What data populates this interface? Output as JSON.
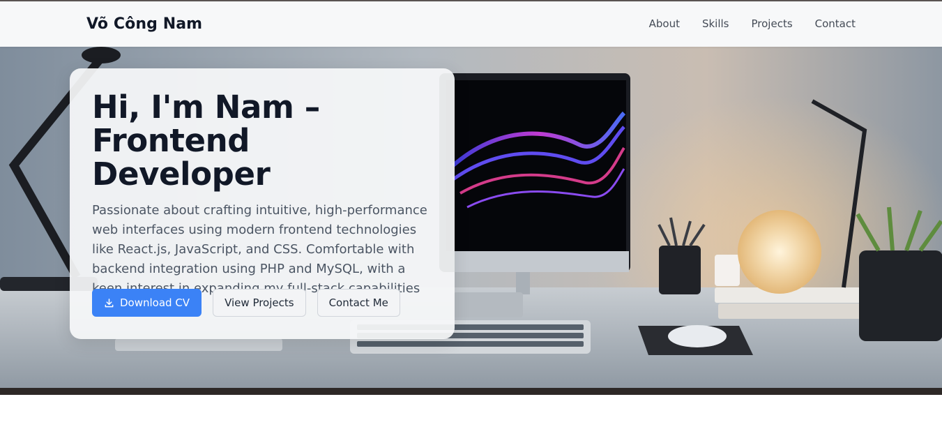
{
  "navbar": {
    "brand": "Võ Công Nam",
    "links": [
      "About",
      "Skills",
      "Projects",
      "Contact"
    ]
  },
  "hero": {
    "title": "Hi, I'm Nam – Frontend Developer",
    "description": "Passionate about crafting intuitive, high-performance web interfaces using modern frontend technologies like React.js, JavaScript, and CSS. Comfortable with backend integration using PHP and MySQL, with a keen interest in expanding my full-stack capabilities",
    "buttons": {
      "download_cv": "Download CV",
      "view_projects": "View Projects",
      "contact_me": "Contact Me"
    },
    "icons": {
      "download": "download-icon"
    }
  },
  "colors": {
    "primary": "#3b82f6",
    "title": "#111827",
    "text": "#4b5563",
    "navbar_bg": "#f7f8f9"
  }
}
